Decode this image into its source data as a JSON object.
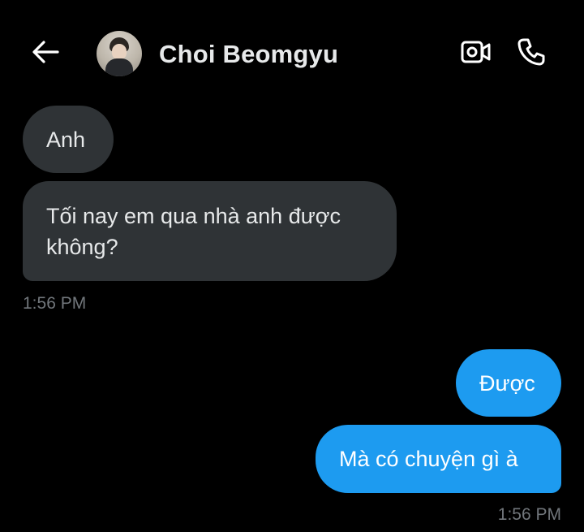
{
  "header": {
    "back_icon": "arrow-left-icon",
    "avatar_alt": "profile photo",
    "contact_name": "Choi Beomgyu",
    "video_icon": "video-camera-icon",
    "call_icon": "phone-icon"
  },
  "messages": [
    {
      "direction": "received",
      "text": "Anh"
    },
    {
      "direction": "received",
      "text": "Tối nay em qua nhà anh được không?"
    },
    {
      "direction": "sent",
      "text": "Được"
    },
    {
      "direction": "sent",
      "text": "Mà có chuyện gì à"
    }
  ],
  "timestamps": {
    "received_group": "1:56 PM",
    "sent_group": "1:56 PM"
  },
  "colors": {
    "background": "#000000",
    "received_bubble": "#2f3336",
    "sent_bubble": "#1d9bf0",
    "text_primary": "#e7e9ea",
    "text_secondary": "#71767b"
  }
}
